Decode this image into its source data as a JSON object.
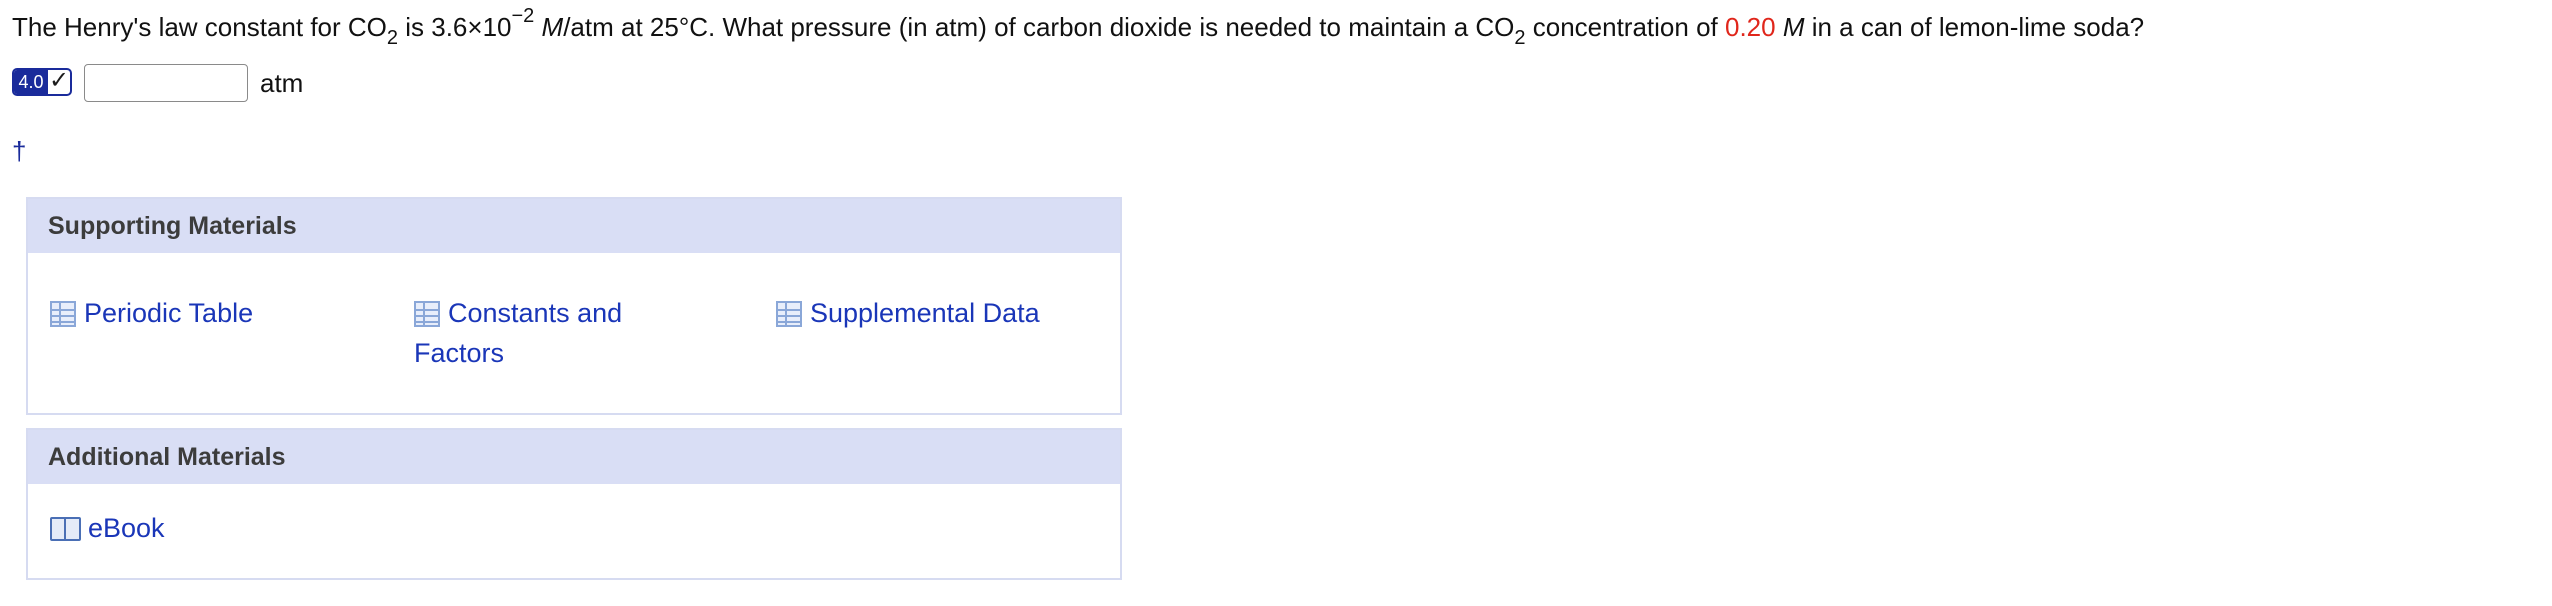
{
  "question": {
    "part1": "The Henry's law constant for CO",
    "sub1": "2",
    "part2": " is 3.6×10",
    "sup1": "−2",
    "unit_italic": " M",
    "part3": "/atm at 25°C. What pressure (in atm) of carbon dioxide is needed to maintain a CO",
    "sub2": "2",
    "part4": " concentration of ",
    "highlight_value": "0.20",
    "part5_italic": " M",
    "part6": " in a can of lemon-lime soda?"
  },
  "answer": {
    "score_points": "4.0",
    "check_glyph": "✓",
    "input_value": "",
    "unit_label": "atm"
  },
  "dagger_glyph": "†",
  "supporting": {
    "title": "Supporting Materials",
    "links": [
      {
        "label": "Periodic Table",
        "icon": "table-icon"
      },
      {
        "label_line1": "Constants and",
        "label_line2": "Factors",
        "icon": "table-icon"
      },
      {
        "label": "Supplemental Data",
        "icon": "table-icon"
      }
    ]
  },
  "additional": {
    "title": "Additional Materials",
    "links": [
      {
        "label": "eBook",
        "icon": "book-icon"
      }
    ]
  },
  "colors": {
    "highlight_red": "#e0261b",
    "link_blue": "#1a36b8",
    "badge_navy": "#1a2b9b",
    "panel_header": "#d9def5"
  }
}
